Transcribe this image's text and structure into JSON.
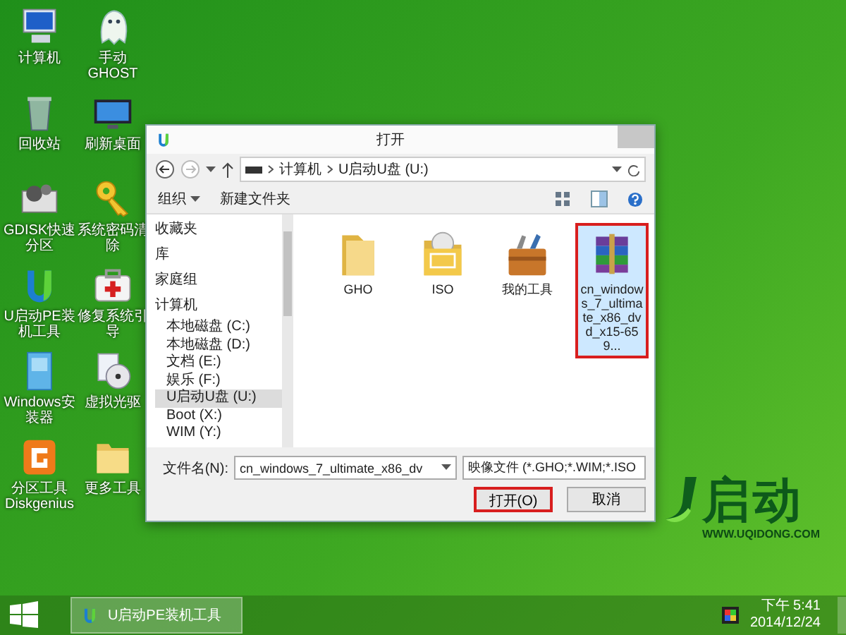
{
  "desktop_icons": [
    {
      "label": "计算机"
    },
    {
      "label": "手动GHOST"
    },
    {
      "label": "回收站"
    },
    {
      "label": "刷新桌面"
    },
    {
      "label": "GDISK快速分区"
    },
    {
      "label": "系统密码清除"
    },
    {
      "label": "U启动PE装机工具"
    },
    {
      "label": "修复系统引导"
    },
    {
      "label": "Windows安装器"
    },
    {
      "label": "虚拟光驱"
    },
    {
      "label": "分区工具 Diskgenius"
    },
    {
      "label": "更多工具"
    }
  ],
  "wallpaper_logo": {
    "brand": "启动",
    "url": "WWW.UQIDONG.COM"
  },
  "dialog": {
    "title": "打开",
    "breadcrumb": [
      "计算机",
      "U启动U盘 (U:)"
    ],
    "toolbar": {
      "organize": "组织",
      "new_folder": "新建文件夹"
    },
    "sidebar": [
      {
        "label": "收藏夹",
        "selected": false
      },
      {
        "label": "库",
        "selected": false
      },
      {
        "label": "家庭组",
        "selected": false
      },
      {
        "label": "计算机",
        "selected": false,
        "children": [
          {
            "label": "本地磁盘 (C:)",
            "selected": false
          },
          {
            "label": "本地磁盘 (D:)",
            "selected": false
          },
          {
            "label": "文档 (E:)",
            "selected": false
          },
          {
            "label": "娱乐 (F:)",
            "selected": false
          },
          {
            "label": "U启动U盘 (U:)",
            "selected": true
          },
          {
            "label": "Boot (X:)",
            "selected": false
          },
          {
            "label": "WIM (Y:)",
            "selected": false
          }
        ]
      }
    ],
    "files": [
      {
        "name": "GHO",
        "selected": false,
        "highlighted": false
      },
      {
        "name": "ISO",
        "selected": false,
        "highlighted": false
      },
      {
        "name": "我的工具",
        "selected": false,
        "highlighted": false
      },
      {
        "name": "cn_windows_7_ultimate_x86_dvd_x15-659...",
        "selected": true,
        "highlighted": true
      }
    ],
    "filename": {
      "label": "文件名(N):",
      "value": "cn_windows_7_ultimate_x86_dv"
    },
    "filter": "映像文件 (*.GHO;*.WIM;*.ISO",
    "buttons": [
      {
        "label": "打开(O)",
        "highlighted": true
      },
      {
        "label": "取消",
        "highlighted": false
      }
    ]
  },
  "taskbar": {
    "tasks": [
      {
        "label": "U启动PE装机工具",
        "selected": true
      }
    ],
    "time": "下午 5:41",
    "date": "2014/12/24"
  }
}
